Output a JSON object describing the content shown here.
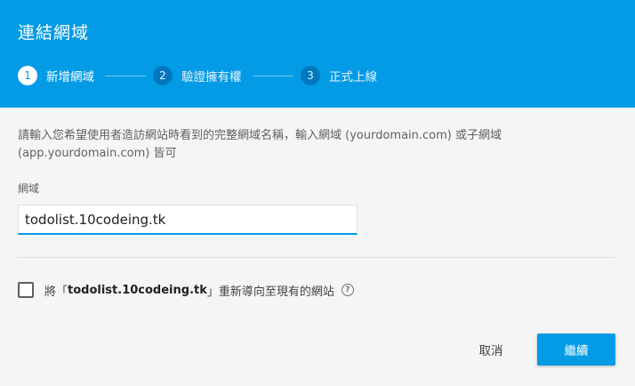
{
  "dialog": {
    "title": "連結網域"
  },
  "stepper": {
    "steps": [
      {
        "number": "1",
        "label": "新增網域",
        "state": "active"
      },
      {
        "number": "2",
        "label": "驗證擁有權",
        "state": "inactive"
      },
      {
        "number": "3",
        "label": "正式上線",
        "state": "inactive"
      }
    ]
  },
  "form": {
    "description": "請輸入您希望使用者造訪網站時看到的完整網域名稱，輸入網域 (yourdomain.com) 或子網域 (app.yourdomain.com) 皆可",
    "domain_label": "網域",
    "domain_value": "todolist.10codeing.tk",
    "redirect": {
      "prefix": "將「",
      "domain": "todolist.10codeing.tk",
      "suffix": "」重新導向至現有的網站",
      "checked": false,
      "help_icon": "help-circle-icon"
    }
  },
  "actions": {
    "cancel_label": "取消",
    "continue_label": "繼續"
  },
  "colors": {
    "header": "#039be5",
    "accent": "#039be5",
    "step_inactive": "#0277bd"
  }
}
